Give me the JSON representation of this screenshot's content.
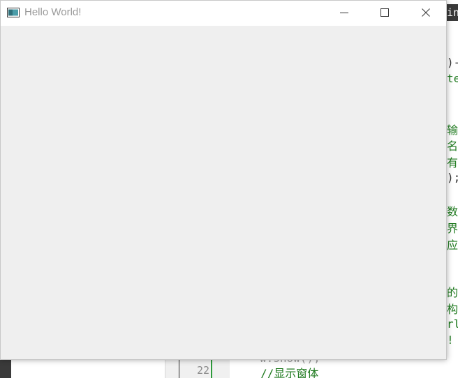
{
  "background_editor": {
    "line_number": "22",
    "comment_line": "//显示窗体",
    "partial_line_above": "w.show();",
    "right_edge_fragments": [
      {
        "text": "in",
        "color": "#ffffff"
      },
      {
        "text": ")-",
        "color": "#333333"
      },
      {
        "text": "te.",
        "color": "#1f7a1f"
      },
      {
        "text": "输",
        "color": "#1f7a1f"
      },
      {
        "text": "名",
        "color": "#1f7a1f"
      },
      {
        "text": "有,",
        "color": "#1f7a1f"
      },
      {
        "text": ");",
        "color": "#333333"
      },
      {
        "text": "数",
        "color": "#1f7a1f"
      },
      {
        "text": "界",
        "color": "#1f7a1f"
      },
      {
        "text": "应",
        "color": "#1f7a1f"
      },
      {
        "text": "的基",
        "color": "#1f7a1f"
      },
      {
        "text": "构造",
        "color": "#1f7a1f"
      },
      {
        "text": "rlc",
        "color": "#1f7a1f"
      },
      {
        "text": "!",
        "color": "#1f7a1f"
      }
    ]
  },
  "window": {
    "title": "Hello World!",
    "icon": "app-window-icon",
    "controls": {
      "minimize_icon": "minimize-icon",
      "maximize_icon": "maximize-icon",
      "close_icon": "close-icon"
    },
    "colors": {
      "titlebar": "#ffffff",
      "client": "#efefef",
      "title_text": "#9a9a9a"
    }
  }
}
